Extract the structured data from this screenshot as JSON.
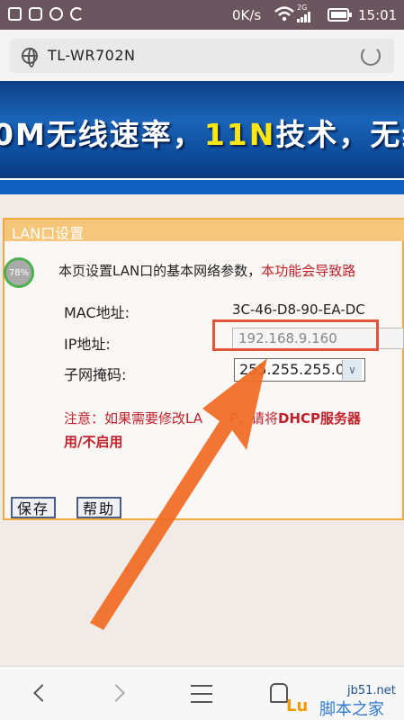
{
  "status_bar": {
    "speed": "0K/s",
    "network": "2G",
    "time": "15:01"
  },
  "address_bar": {
    "url": "TL-WR702N"
  },
  "banner": {
    "part1": "0M无线速率，",
    "highlight": "11N",
    "part2": "技术，无线生"
  },
  "panel": {
    "title": "LAN口设置",
    "progress": "78%",
    "desc_black": "本页设置LAN口的基本网络参数，",
    "desc_red": "本功能会导致路",
    "mac_label": "MAC地址:",
    "mac_value": "3C-46-D8-90-EA-DC",
    "ip_label": "IP地址:",
    "ip_value": "192.168.9.160",
    "mask_label": "子网掩码:",
    "mask_value": "255.255.255.0",
    "note_line1_a": "注意：如果需要修改LA",
    "note_line1_b": "P，请将",
    "note_line1_bold": "DHCP服务器",
    "note_line2": "用/不启用"
  },
  "buttons": {
    "save": "保存",
    "help": "帮助"
  },
  "watermark": {
    "site": "jb51.net",
    "brand_a": "Lu",
    "brand_b": "脚本之家"
  },
  "colors": {
    "panel_border": "#f0a93c",
    "annotation": "#e2543a",
    "warning_text": "#c0202a"
  }
}
